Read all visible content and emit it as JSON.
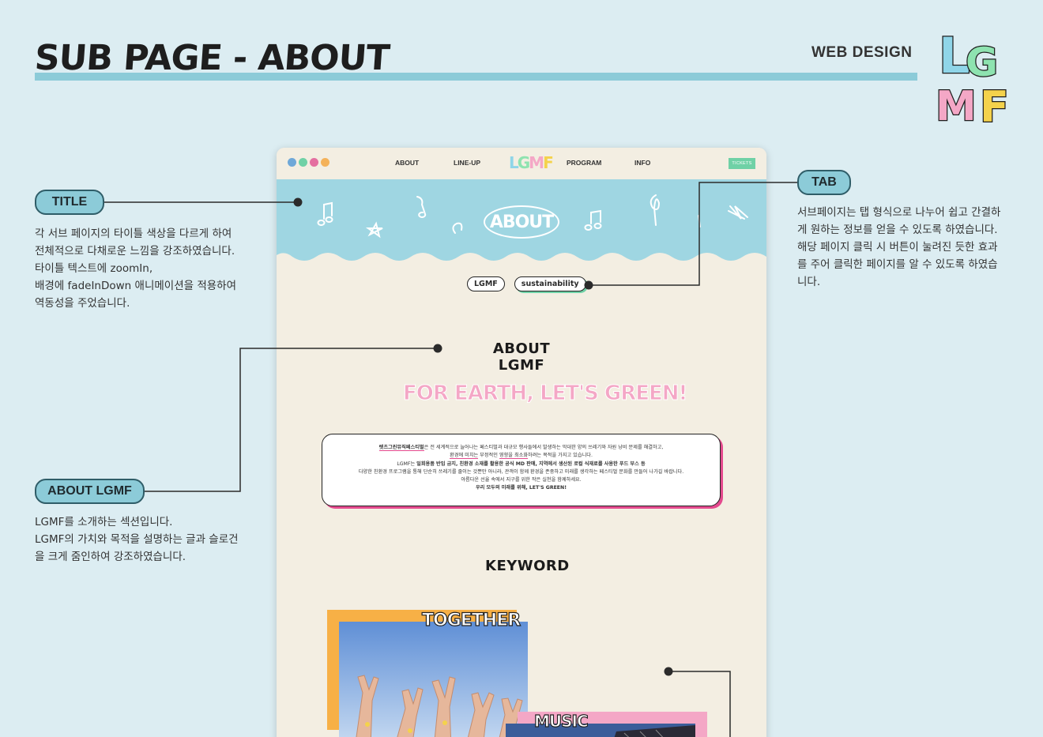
{
  "header": {
    "title": "SUB PAGE - ABOUT",
    "category": "WEB DESIGN",
    "logo_letters": [
      "L",
      "G",
      "M",
      "F"
    ]
  },
  "annotations": {
    "title": {
      "label": "TITLE",
      "lines": [
        "각 서브 페이지의 타이틀 색상을 다르게 하여",
        "전체적으로 다채로운 느낌을 강조하였습니다.",
        "타이틀 텍스트에 zoomIn,",
        "배경에 fadeInDown 애니메이션을 적용하여",
        "역동성을 주었습니다."
      ]
    },
    "tab": {
      "label": "TAB",
      "lines": [
        "서브페이지는 탭 형식으로 나누어 쉽고 간결하",
        "게 원하는 정보를 얻을 수 있도록 하였습니다.",
        "해당 페이지 클릭 시 버튼이 눌려진 듯한 효과",
        "를 주어 클릭한 페이지를 알 수 있도록 하였습",
        "니다."
      ]
    },
    "about_lgmf": {
      "label": "ABOUT LGMF",
      "lines": [
        "LGMF를 소개하는 섹션입니다.",
        "LGMF의 가치와 목적을 설명하는 글과 슬로건",
        "을 크게 줌인하여 강조하였습니다."
      ]
    }
  },
  "mockup": {
    "nav": {
      "items": [
        "ABOUT",
        "LINE-UP",
        "PROGRAM",
        "INFO"
      ],
      "logo": "LGMF",
      "tickets": "TICKETS",
      "social_icons": [
        "facebook-icon",
        "x-icon",
        "youtube-icon",
        "instagram-icon"
      ]
    },
    "hero_title": "ABOUT",
    "tabs": [
      "LGMF",
      "sustainability"
    ],
    "active_tab": "sustainability",
    "about_title": "ABOUT LGMF",
    "slogan": "FOR EARTH, LET'S GREEN!",
    "description": {
      "line1_highlight": "렛츠그린뮤직페스티벌",
      "line1_rest": "은 전 세계적으로 늘어나는 페스티벌과 대규모 행사들에서 발생하는 막대한 양의 쓰레기와 자원 낭비 문제를 해결하고,",
      "line2_underline1": "환경에 미치는",
      "line2_mid": " 부정적인 ",
      "line2_underline2": "영향을 최소화",
      "line2_rest": "하려는 목적을 가지고 있습니다.",
      "line3_prefix": "LGMF는 ",
      "line3_bold": "일회용품 반입 금지, 친환경 소재를 활용한 공식 MD 판매, 지역에서 생산된 로컬 식재료를 사용한 푸드 부스 등",
      "line4": "다양한 친환경 프로그램을 통해 단순히 쓰레기를 줄이는 것뿐만 아니라, 관객이 함께 환경을 존중하고 미래를 생각하는 페스티벌 문화를 만들어 나가길 바랍니다.",
      "line5": "아름다운 선율 속에서 지구를 위한 작은 실천을 함께하세요.",
      "line6": "우리 모두의 미래를 위해, LET'S GREEN!"
    },
    "keyword_title": "KEYWORD",
    "keywords": [
      "TOGETHER",
      "MUSIC"
    ]
  },
  "colors": {
    "page_bg": "#dcedf2",
    "accent_blue": "#8ccbd8",
    "mockup_bg": "#f3eee2",
    "hero_blue": "#9fd6e2",
    "pink": "#e44a8e",
    "green": "#6fd1a6",
    "orange": "#f7b046",
    "yellow": "#f4d24b"
  }
}
